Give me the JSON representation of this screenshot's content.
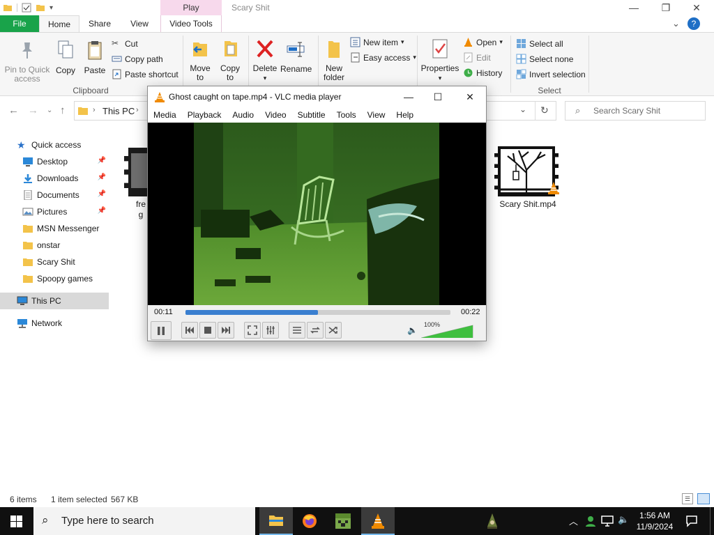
{
  "explorer": {
    "context_tab": "Play",
    "window_title": "Scary Shit",
    "tabs": {
      "file": "File",
      "home": "Home",
      "share": "Share",
      "view": "View",
      "video_tools": "Video Tools"
    },
    "clipboard": {
      "pin": "Pin to Quick access",
      "copy": "Copy",
      "paste": "Paste",
      "cut": "Cut",
      "copy_path": "Copy path",
      "paste_shortcut": "Paste shortcut",
      "label": "Clipboard"
    },
    "organize": {
      "move_to": "Move to",
      "copy_to": "Copy to",
      "delete": "Delete",
      "rename": "Rename"
    },
    "new": {
      "new_folder": "New folder",
      "new_item": "New item",
      "easy_access": "Easy access"
    },
    "open": {
      "properties": "Properties",
      "open": "Open",
      "edit": "Edit",
      "history": "History"
    },
    "select": {
      "select_all": "Select all",
      "select_none": "Select none",
      "invert": "Invert selection",
      "label": "Select"
    },
    "address": {
      "path": "This PC",
      "search_placeholder": "Search Scary Shit"
    },
    "nav_pane": {
      "quick_access": "Quick access",
      "items": [
        "Desktop",
        "Downloads",
        "Documents",
        "Pictures",
        "MSN Messenger",
        "onstar",
        "Scary Shit",
        "Spoopy games"
      ],
      "this_pc": "This PC",
      "network": "Network"
    },
    "files": [
      {
        "name_line1": "fre",
        "name_line2": "g"
      },
      {
        "name_line1": "Scary Shit.mp4"
      }
    ],
    "status": {
      "count": "6 items",
      "selected": "1 item selected",
      "size": "567 KB"
    }
  },
  "vlc": {
    "title": "Ghost caught on tape.mp4 - VLC media player",
    "menu": [
      "Media",
      "Playback",
      "Audio",
      "Video",
      "Subtitle",
      "Tools",
      "View",
      "Help"
    ],
    "time_elapsed": "00:11",
    "time_total": "00:22",
    "progress": 0.5,
    "volume_label": "100%",
    "volume": 1.0
  },
  "taskbar": {
    "search_placeholder": "Type here to search",
    "time": "1:56 AM",
    "date": "11/9/2024"
  },
  "colors": {
    "file_tab": "#19a34a",
    "context_tab": "#f7d9ec",
    "seek_fill": "#3a7fd0",
    "volume_fill": "#3fbf3f",
    "night_vision": "#2f6a1e"
  }
}
